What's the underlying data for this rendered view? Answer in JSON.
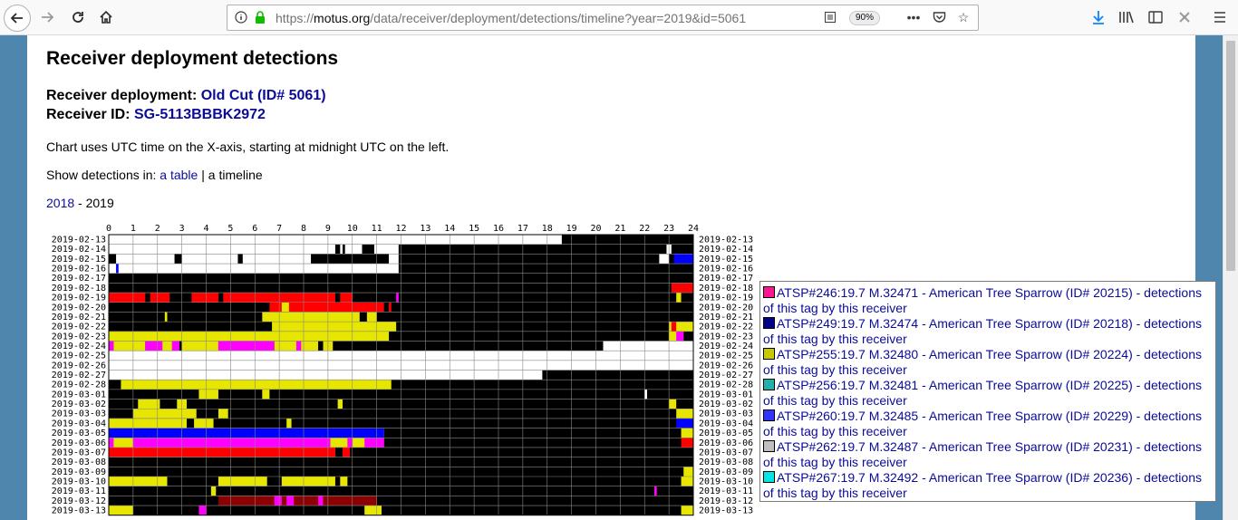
{
  "browser": {
    "url_prefix": "https://",
    "url_host": "motus.org",
    "url_path": "/data/receiver/deployment/detections/timeline?year=2019&id=5061",
    "zoom": "90%"
  },
  "page": {
    "title": "Receiver deployment detections",
    "deployment_label": "Receiver deployment:",
    "deployment_link": "Old Cut (ID# 5061)",
    "receiver_label": "Receiver ID:",
    "receiver_link": "SG-5113BBBK2972",
    "note": "Chart uses UTC time on the X-axis, starting at midnight UTC on the left.",
    "show_prefix": "Show detections in:",
    "show_table_link": "a table",
    "show_sep": "|",
    "show_timeline": "a timeline",
    "year_link": "2018",
    "year_sep": "-",
    "year_current": "2019"
  },
  "legend": [
    {
      "label": "ATSP#246:19.7 M.32471 - American Tree Sparrow (ID# 20215) - detections of this tag by this receiver",
      "color": "#ff1493"
    },
    {
      "label": "ATSP#249:19.7 M.32474 - American Tree Sparrow (ID# 20218) - detections of this tag by this receiver",
      "color": "#00008b"
    },
    {
      "label": "ATSP#255:19.7 M.32480 - American Tree Sparrow (ID# 20224) - detections of this tag by this receiver",
      "color": "#c8c800"
    },
    {
      "label": "ATSP#256:19.7 M.32481 - American Tree Sparrow (ID# 20225) - detections of this tag by this receiver",
      "color": "#20b2aa"
    },
    {
      "label": "ATSP#260:19.7 M.32485 - American Tree Sparrow (ID# 20229) - detections of this tag by this receiver",
      "color": "#3333ff"
    },
    {
      "label": "ATSP#262:19.7 M.32487 - American Tree Sparrow (ID# 20231) - detections of this tag by this receiver",
      "color": "#c0c0c0"
    },
    {
      "label": "ATSP#267:19.7 M.32492 - American Tree Sparrow (ID# 20236) - detections of this tag by this receiver",
      "color": "#00e5e5"
    }
  ],
  "chart_data": {
    "type": "heatmap",
    "x_ticks": [
      "0",
      "1",
      "2",
      "3",
      "4",
      "5",
      "6",
      "7",
      "8",
      "9",
      "10",
      "11",
      "12",
      "13",
      "14",
      "15",
      "16",
      "17",
      "18",
      "19",
      "20",
      "21",
      "22",
      "23",
      "24"
    ],
    "dates": [
      "2019-02-13",
      "2019-02-14",
      "2019-02-15",
      "2019-02-16",
      "2019-02-17",
      "2019-02-18",
      "2019-02-19",
      "2019-02-20",
      "2019-02-21",
      "2019-02-22",
      "2019-02-23",
      "2019-02-24",
      "2019-02-25",
      "2019-02-26",
      "2019-02-27",
      "2019-02-28",
      "2019-03-01",
      "2019-03-02",
      "2019-03-03",
      "2019-03-04",
      "2019-03-05",
      "2019-03-06",
      "2019-03-07",
      "2019-03-08",
      "2019-03-09",
      "2019-03-10",
      "2019-03-11",
      "2019-03-12",
      "2019-03-13"
    ],
    "colors": {
      "black": "#000000",
      "white": "#ffffff",
      "red": "#ff0000",
      "darkred": "#8b0000",
      "yellow": "#e6e600",
      "magenta": "#ff00ff",
      "blue": "#0000ff"
    },
    "rows": [
      [
        [
          0,
          18.6,
          "white"
        ],
        [
          18.6,
          24,
          "black"
        ]
      ],
      [
        [
          0,
          11.9,
          "white"
        ],
        [
          9.3,
          9.5,
          "black"
        ],
        [
          9.6,
          9.7,
          "black"
        ],
        [
          10.4,
          10.9,
          "black"
        ],
        [
          11.9,
          22.9,
          "black"
        ],
        [
          23.1,
          24,
          "black"
        ]
      ],
      [
        [
          0,
          8.3,
          "white"
        ],
        [
          0,
          0.3,
          "black"
        ],
        [
          2.7,
          3,
          "black"
        ],
        [
          5.3,
          5.5,
          "black"
        ],
        [
          8.3,
          11.5,
          "black"
        ],
        [
          11.5,
          11.9,
          "white"
        ],
        [
          11.9,
          22.6,
          "black"
        ],
        [
          23,
          23.2,
          "black"
        ],
        [
          23.2,
          24,
          "blue"
        ]
      ],
      [
        [
          0,
          11.9,
          "white"
        ],
        [
          0.3,
          0.4,
          "blue"
        ],
        [
          8.3,
          11.9,
          "white"
        ],
        [
          11.9,
          24,
          "black"
        ]
      ],
      [
        [
          0,
          24,
          "black"
        ]
      ],
      [
        [
          0,
          24,
          "black"
        ],
        [
          23.1,
          24,
          "red"
        ]
      ],
      [
        [
          0,
          24,
          "black"
        ],
        [
          0,
          1.5,
          "red"
        ],
        [
          1.7,
          2.5,
          "red"
        ],
        [
          3.4,
          4.5,
          "red"
        ],
        [
          4.7,
          9.3,
          "red"
        ],
        [
          9.5,
          10,
          "red"
        ],
        [
          11.8,
          11.9,
          "magenta"
        ],
        [
          23.3,
          23.5,
          "yellow"
        ]
      ],
      [
        [
          0,
          24,
          "black"
        ],
        [
          6.6,
          11.3,
          "red"
        ],
        [
          11.5,
          11.6,
          "red"
        ],
        [
          7.1,
          7.4,
          "yellow"
        ]
      ],
      [
        [
          0,
          24,
          "black"
        ],
        [
          6.3,
          10.3,
          "yellow"
        ],
        [
          10.6,
          11,
          "yellow"
        ],
        [
          2.3,
          2.4,
          "yellow"
        ]
      ],
      [
        [
          0,
          24,
          "black"
        ],
        [
          6.7,
          11.8,
          "yellow"
        ],
        [
          23,
          24,
          "yellow"
        ],
        [
          23.1,
          23.3,
          "red"
        ]
      ],
      [
        [
          0,
          11.5,
          "yellow"
        ],
        [
          11.5,
          23,
          "black"
        ],
        [
          23,
          23.5,
          "yellow"
        ],
        [
          23.3,
          23.6,
          "magenta"
        ],
        [
          23.6,
          24,
          "black"
        ]
      ],
      [
        [
          0,
          20.3,
          "black"
        ],
        [
          0,
          0.2,
          "magenta"
        ],
        [
          0.2,
          1.5,
          "yellow"
        ],
        [
          1.5,
          2.2,
          "magenta"
        ],
        [
          2.2,
          2.6,
          "yellow"
        ],
        [
          2.6,
          2.9,
          "magenta"
        ],
        [
          3,
          4.5,
          "yellow"
        ],
        [
          4.5,
          6.8,
          "magenta"
        ],
        [
          6.8,
          8.6,
          "yellow"
        ],
        [
          7.7,
          7.9,
          "magenta"
        ],
        [
          8.6,
          9,
          "black"
        ],
        [
          8.8,
          9.2,
          "yellow"
        ],
        [
          20.3,
          24,
          "white"
        ]
      ],
      [
        [
          0,
          24,
          "white"
        ]
      ],
      [
        [
          0,
          24,
          "white"
        ]
      ],
      [
        [
          0,
          17.8,
          "white"
        ],
        [
          17.8,
          24,
          "black"
        ]
      ],
      [
        [
          0,
          24,
          "black"
        ],
        [
          0.5,
          11.6,
          "yellow"
        ]
      ],
      [
        [
          0,
          24,
          "black"
        ],
        [
          3.7,
          4.5,
          "yellow"
        ],
        [
          6.3,
          6.6,
          "yellow"
        ],
        [
          22,
          22.1,
          "white"
        ]
      ],
      [
        [
          0,
          24,
          "black"
        ],
        [
          1.2,
          2.1,
          "yellow"
        ],
        [
          2.8,
          3.2,
          "yellow"
        ],
        [
          9.4,
          9.6,
          "yellow"
        ],
        [
          23,
          23.3,
          "yellow"
        ]
      ],
      [
        [
          0,
          24,
          "black"
        ],
        [
          1,
          3.6,
          "yellow"
        ],
        [
          4.5,
          4.9,
          "yellow"
        ],
        [
          23.3,
          24,
          "yellow"
        ]
      ],
      [
        [
          0,
          24,
          "black"
        ],
        [
          0,
          3.2,
          "yellow"
        ],
        [
          3.5,
          4.3,
          "yellow"
        ],
        [
          7.3,
          7.5,
          "yellow"
        ],
        [
          23.3,
          24,
          "blue"
        ]
      ],
      [
        [
          0,
          11.3,
          "blue"
        ],
        [
          11.3,
          24,
          "black"
        ],
        [
          23.5,
          24,
          "yellow"
        ]
      ],
      [
        [
          0,
          11.3,
          "magenta"
        ],
        [
          0.2,
          1,
          "yellow"
        ],
        [
          9.1,
          9.8,
          "yellow"
        ],
        [
          10,
          10.5,
          "yellow"
        ],
        [
          11.3,
          24,
          "black"
        ],
        [
          23.5,
          24,
          "red"
        ]
      ],
      [
        [
          0,
          9.3,
          "red"
        ],
        [
          9.3,
          24,
          "black"
        ],
        [
          9.6,
          9.9,
          "red"
        ]
      ],
      [
        [
          0,
          24,
          "black"
        ]
      ],
      [
        [
          0,
          24,
          "black"
        ],
        [
          23.6,
          24,
          "yellow"
        ]
      ],
      [
        [
          0,
          24,
          "black"
        ],
        [
          0,
          2.4,
          "yellow"
        ],
        [
          4.5,
          6.5,
          "yellow"
        ],
        [
          7.1,
          9.3,
          "yellow"
        ],
        [
          9.5,
          9.8,
          "yellow"
        ],
        [
          23.5,
          24,
          "yellow"
        ]
      ],
      [
        [
          0,
          24,
          "black"
        ],
        [
          22.4,
          22.5,
          "magenta"
        ],
        [
          4.2,
          4.4,
          "yellow"
        ]
      ],
      [
        [
          0,
          24,
          "black"
        ],
        [
          4.5,
          11,
          "darkred"
        ],
        [
          6.8,
          7.1,
          "magenta"
        ],
        [
          7.3,
          7.6,
          "magenta"
        ],
        [
          8.6,
          8.8,
          "magenta"
        ]
      ],
      [
        [
          0,
          24,
          "black"
        ],
        [
          0,
          1,
          "yellow"
        ],
        [
          3.7,
          4,
          "magenta"
        ],
        [
          10.5,
          11.2,
          "yellow"
        ],
        [
          23.5,
          24,
          "yellow"
        ]
      ]
    ]
  }
}
